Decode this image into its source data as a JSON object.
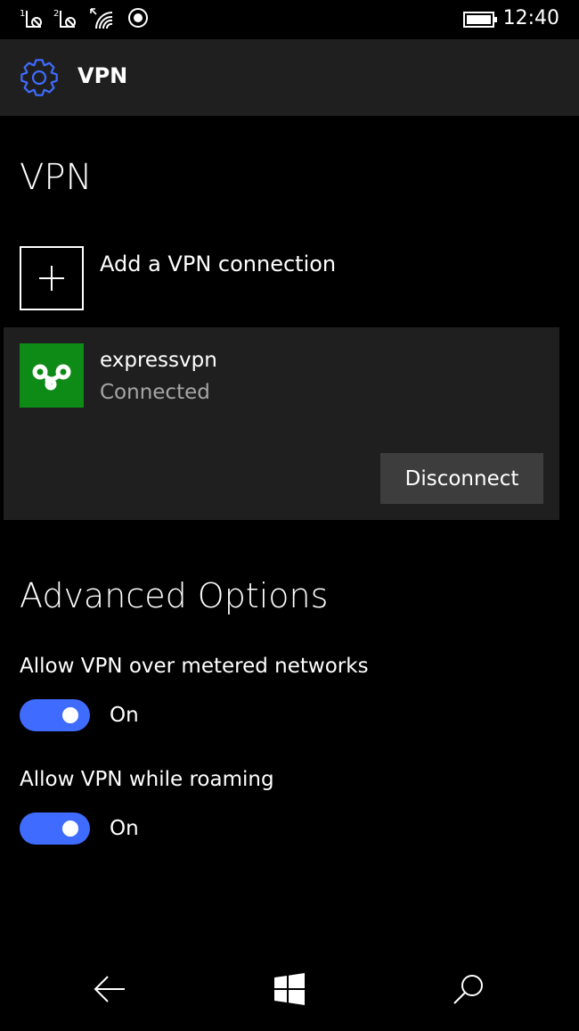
{
  "status_bar": {
    "sim1_label": "1",
    "sim2_label": "2",
    "time": "12:40"
  },
  "app_bar": {
    "title": "VPN"
  },
  "page": {
    "title": "VPN"
  },
  "add_connection": {
    "label": "Add a VPN connection"
  },
  "connection": {
    "name": "expressvpn",
    "status": "Connected",
    "disconnect_label": "Disconnect",
    "logo_color": "#0e8a16"
  },
  "advanced": {
    "title": "Advanced Options",
    "metered": {
      "label": "Allow VPN over metered networks",
      "state": "On"
    },
    "roaming": {
      "label": "Allow VPN while roaming",
      "state": "On"
    }
  },
  "colors": {
    "accent": "#3f6cff",
    "panel": "#1f1f1f"
  },
  "nav": {
    "back_icon": "back-arrow-icon",
    "home_icon": "windows-logo-icon",
    "search_icon": "search-icon"
  }
}
